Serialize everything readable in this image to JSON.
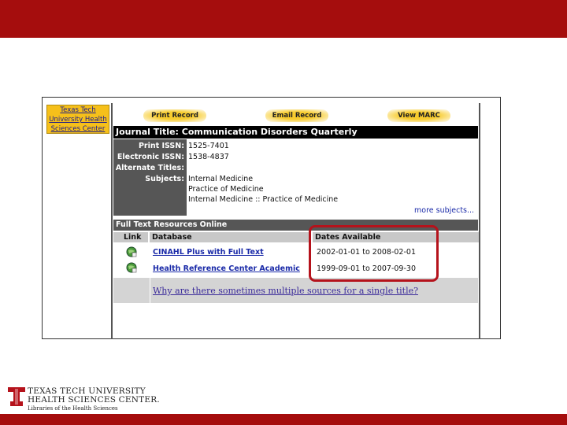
{
  "side_logo": {
    "line1": "Texas Tech",
    "line2": "University Health",
    "line3": "Sciences Center"
  },
  "toolbar": {
    "print": "Print Record",
    "email": "Email Record",
    "marc": "View MARC"
  },
  "journal": {
    "title_bar": "Journal Title: Communication Disorders Quarterly",
    "labels": {
      "print_issn": "Print ISSN:",
      "electronic_issn": "Electronic ISSN:",
      "alternate_titles": "Alternate Titles:",
      "subjects": "Subjects:"
    },
    "print_issn": "1525-7401",
    "electronic_issn": "1538-4837",
    "subjects": [
      "Internal Medicine",
      "Practice of Medicine",
      "Internal Medicine :: Practice of Medicine"
    ],
    "more_subjects": "more subjects..."
  },
  "full_text": {
    "header": "Full Text Resources Online",
    "columns": {
      "link": "Link",
      "database": "Database",
      "dates": "Dates Available"
    },
    "rows": [
      {
        "database": "CINAHL Plus with Full Text",
        "dates": "2002-01-01 to 2008-02-01"
      },
      {
        "database": "Health Reference Center Academic",
        "dates": "1999-09-01 to 2007-09-30"
      }
    ],
    "why_link": "Why are there sometimes multiple sources for a single title?"
  },
  "footer": {
    "line1": "TEXAS TECH UNIVERSITY",
    "line2": "HEALTH SCIENCES CENTER.",
    "line3": "Libraries of the Health Sciences"
  },
  "colors": {
    "brand_red": "#a50d0d",
    "button_gold": "#f6c01a",
    "highlight": "#b5121b"
  }
}
